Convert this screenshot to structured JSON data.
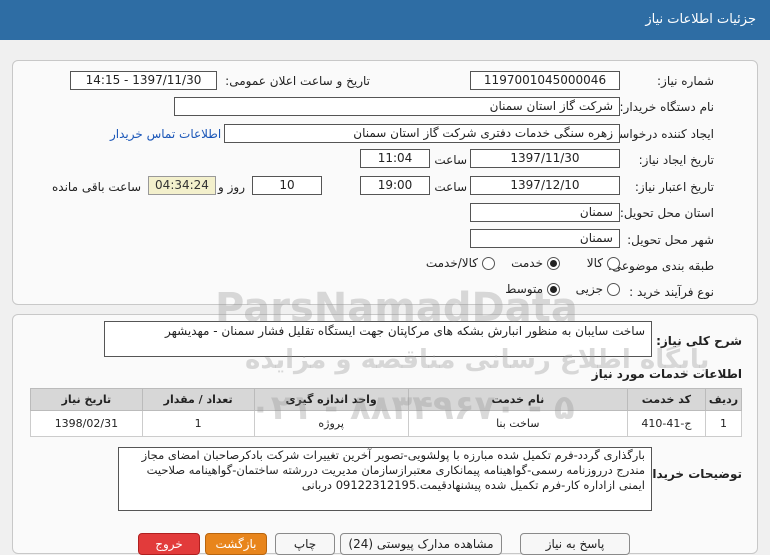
{
  "window": {
    "title": "جزئیات اطلاعات نیاز"
  },
  "form": {
    "need_number_label": "شماره نیاز:",
    "need_number": "1197001045000046",
    "announce_label": "تاریخ و ساعت اعلان عمومی:",
    "announce_value": "1397/11/30 - 14:15",
    "buyer_org_label": "نام دستگاه خریدار:",
    "buyer_org": "شرکت گاز استان سمنان",
    "requester_label": "ایجاد کننده درخواست:",
    "requester": "زهره سنگی خدمات دفتری شرکت گاز استان سمنان",
    "contact_link": "اطلاعات تماس خریدار",
    "created_label": "تاریخ ایجاد نیاز:",
    "created_date": "1397/11/30",
    "time_label": "ساعت",
    "created_time": "11:04",
    "validity_label": "تاریخ اعتبار نیاز:",
    "validity_date": "1397/12/10",
    "validity_time": "19:00",
    "days": "10",
    "days_label": "روز و",
    "remaining": "04:34:24",
    "remaining_label": "ساعت باقی مانده",
    "province_label": "استان محل تحویل:",
    "province": "سمنان",
    "city_label": "شهر محل تحویل:",
    "city": "سمنان",
    "category_label": "طبقه بندی موضوعی:",
    "category_options": [
      "کالا",
      "خدمت",
      "کالا/خدمت"
    ],
    "category_selected": "خدمت",
    "process_label": "نوع فرآیند خرید :",
    "process_options": [
      "جزیی",
      "متوسط"
    ],
    "process_selected": "متوسط"
  },
  "description": {
    "label": "شرح کلی نیاز:",
    "text": "ساخت سایبان به منظور انبارش بشکه های مرکاپتان جهت ایستگاه تقلیل فشار سمنان - مهدیشهر"
  },
  "services": {
    "heading": "اطلاعات خدمات مورد نیاز",
    "columns": [
      "ردیف",
      "کد خدمت",
      "نام خدمت",
      "واحد اندازه گیری",
      "تعداد / مقدار",
      "تاریخ نیاز"
    ],
    "rows": [
      [
        "1",
        "ج-41-410",
        "ساخت بنا",
        "پروژه",
        "1",
        "1398/02/31"
      ]
    ]
  },
  "buyer_notes": {
    "label": "توضیحات خریدار:",
    "text": "بارگذاری گردد-فرم تکمیل شده مبارزه با پولشویی-تصویر آخرین تغییرات شرکت بادکرصاحبان امضای مجاز مندرج درروزنامه رسمی-گواهینامه پیمانکاری معتبرازسازمان مدیریت دررشته ساختمان-گواهینامه صلاحیت ایمنی ازاداره کار-فرم تکمیل شده پیشنهادقیمت.09122312195 دربانی"
  },
  "buttons": {
    "reply": "پاسخ به نیاز",
    "view_docs": "مشاهده مدارک پیوستی (24)",
    "print": "چاپ",
    "back": "بازگشت",
    "exit": "خروج"
  },
  "watermark": {
    "line1": "ParsNamadData",
    "line2": "پایگاه اطلاع رسانی مناقصه و مزایده",
    "line3": "۰۲۱ - ۸۸۳۴۹۶۷۰ - ۵"
  },
  "colors": {
    "titlebar": "#2e6da4",
    "remaining_bg": "#f3f0cc",
    "exit_button": "#e23b3b",
    "back_button": "#e8851c"
  }
}
